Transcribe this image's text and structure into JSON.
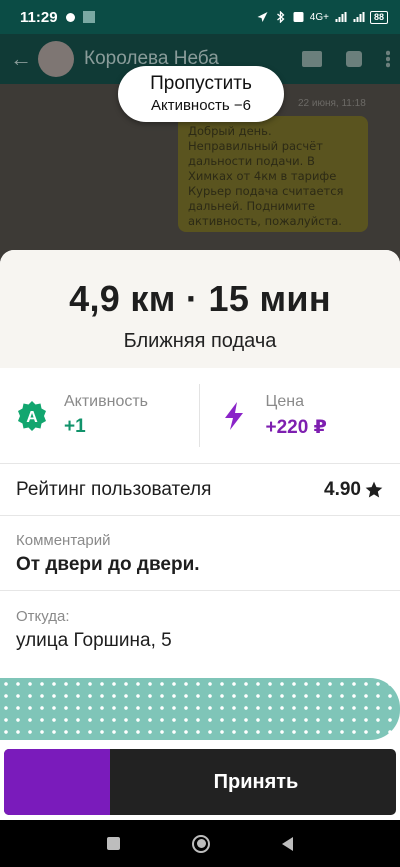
{
  "status_bar": {
    "time": "11:29",
    "battery": "88",
    "network": "4G+"
  },
  "chat": {
    "contact_name": "Королева Неба",
    "message_time": "22 июня, 11:18",
    "message_text": "Добрый день. Неправильный расчёт дальности подачи. В Химках от 4км в тарифе Курьер подача считается дальней. Поднимите активность, пожалуйста."
  },
  "skip": {
    "title": "Пропустить",
    "subtitle": "Активность −6"
  },
  "order": {
    "distance_time": "4,9 км · 15 мин",
    "pickup_type": "Ближняя подача",
    "activity": {
      "label": "Активность",
      "value": "+1",
      "badge_letter": "A"
    },
    "price": {
      "label": "Цена",
      "value": "+220 ₽"
    },
    "rating": {
      "label": "Рейтинг пользователя",
      "value": "4.90",
      "icon": "star-icon"
    },
    "comment": {
      "label": "Комментарий",
      "value": "От двери до двери."
    },
    "from": {
      "label": "Откуда:",
      "value": "улица Горшина, 5"
    }
  },
  "accept": {
    "label": "Принять",
    "progress": 0.27
  },
  "colors": {
    "accent_purple": "#7a1bbb",
    "activity_green": "#12936b",
    "price_purple": "#7e1fb0",
    "status_bar": "#0b4c45"
  }
}
